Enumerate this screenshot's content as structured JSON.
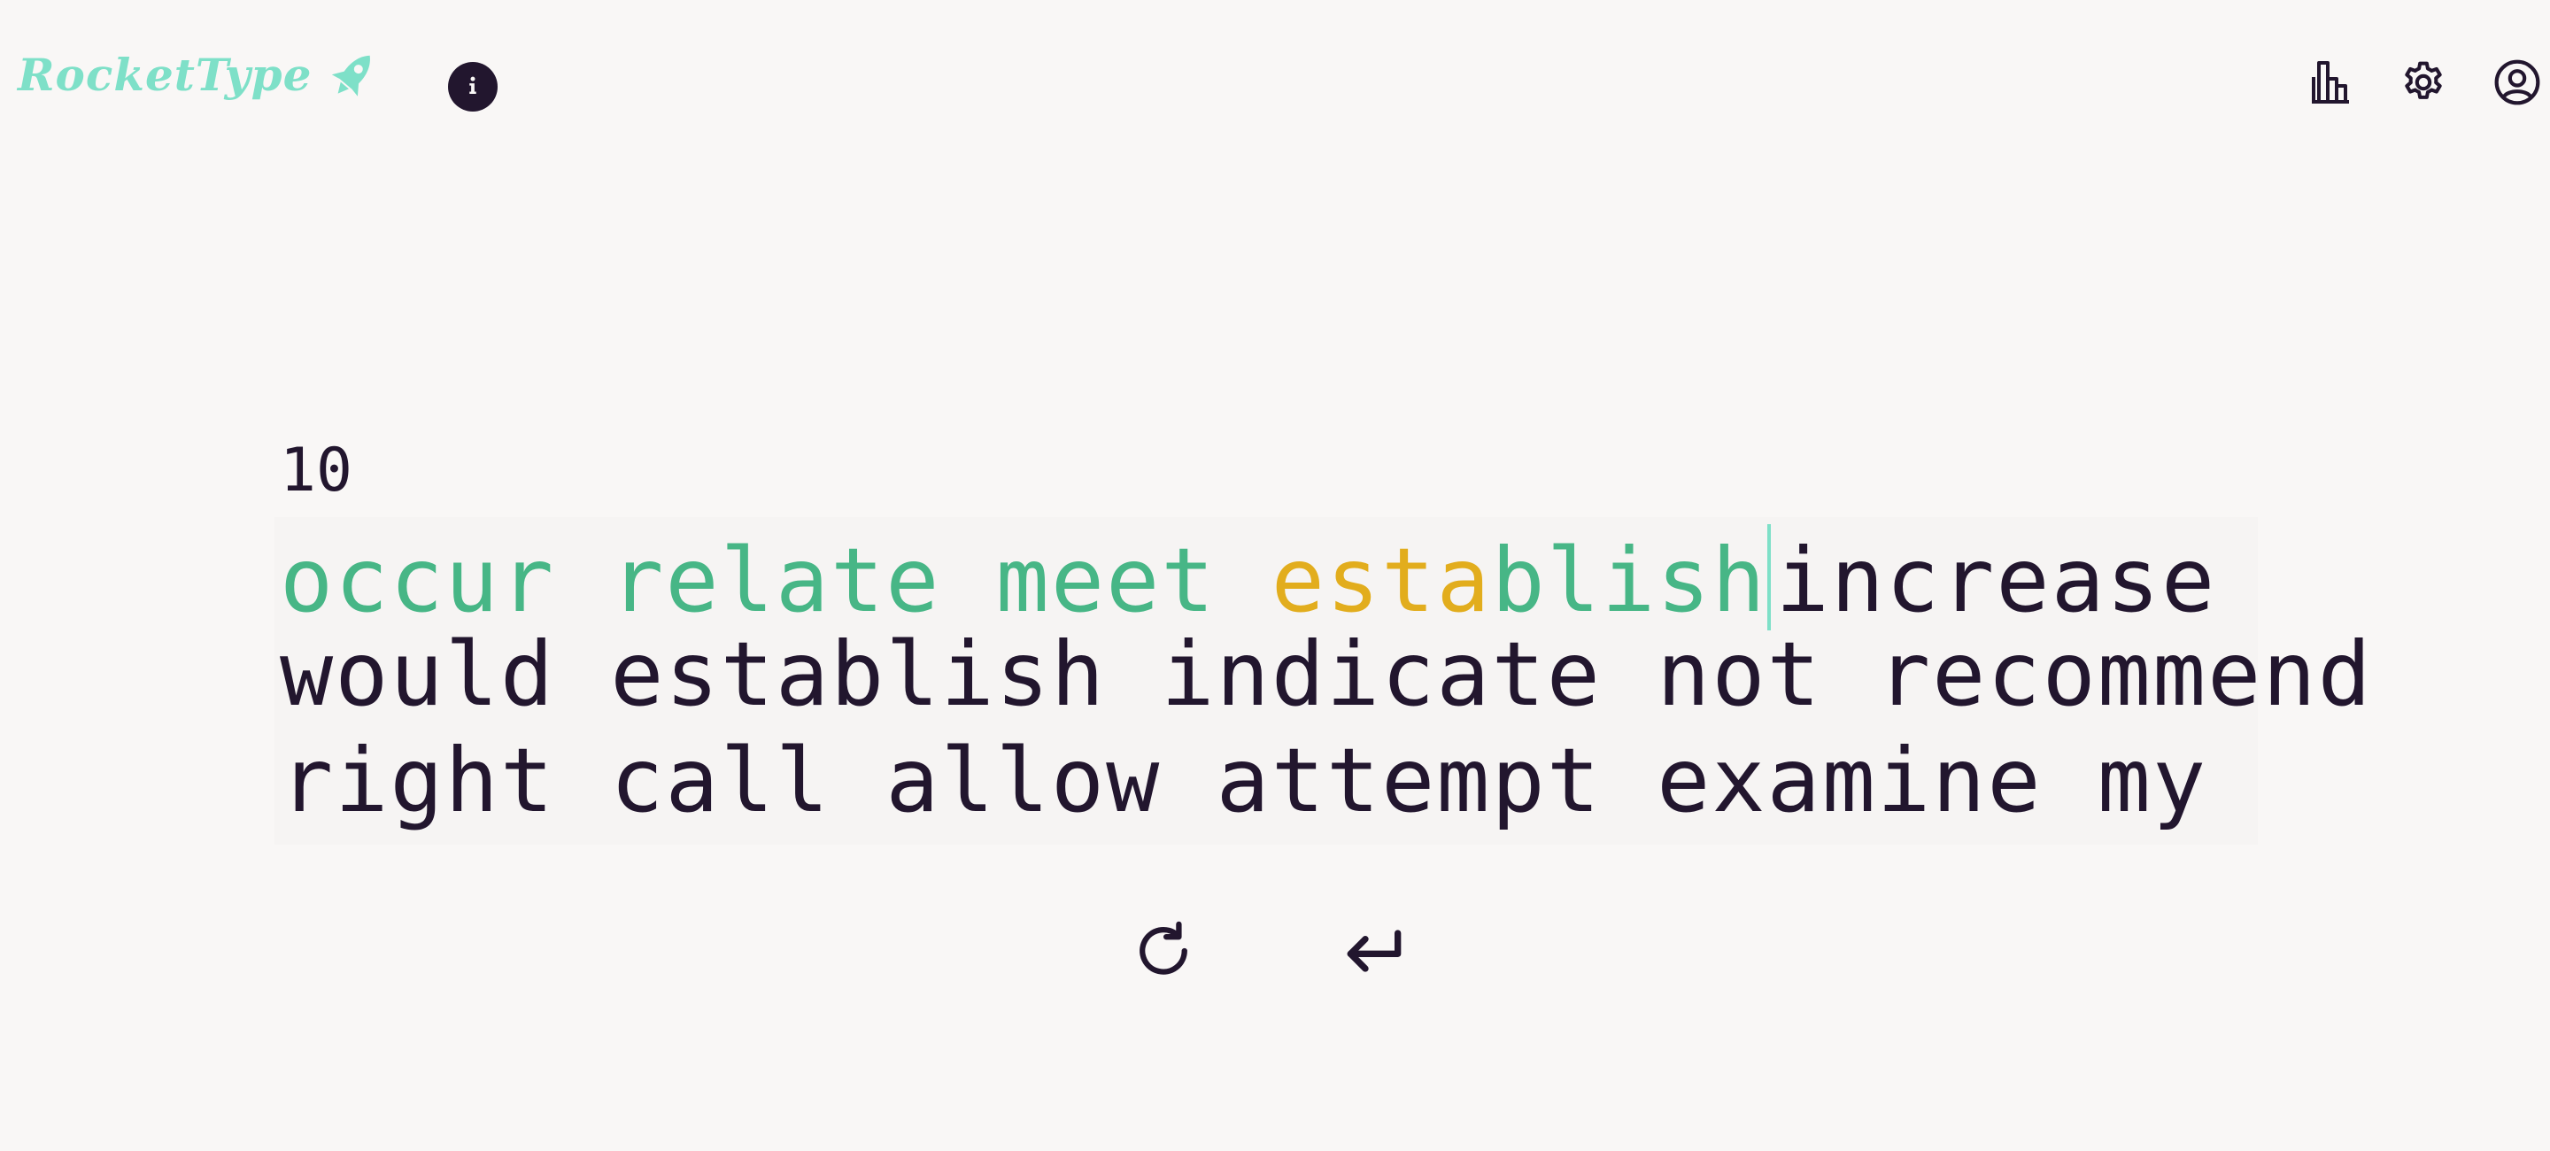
{
  "header": {
    "brand": "RocketType",
    "icons": {
      "logo": "rocket-icon",
      "info": "info-icon",
      "stats": "bar-chart-icon",
      "settings": "gear-icon",
      "account": "user-circle-icon"
    }
  },
  "test": {
    "word_count": "10",
    "line1": {
      "typed_before": "occur relate meet ",
      "current_wrong": "esta",
      "current_right": "blish",
      "rest": "increase"
    },
    "line2": "would establish indicate not recommend",
    "line3": "right call allow attempt examine my"
  },
  "controls": {
    "restart_icon": "restart-icon",
    "next_icon": "enter-arrow-icon"
  },
  "colors": {
    "background": "#f9f7f6",
    "text": "#22162e",
    "correct": "#47b686",
    "error": "#e2ad1d",
    "accent": "#7ee0c8"
  }
}
